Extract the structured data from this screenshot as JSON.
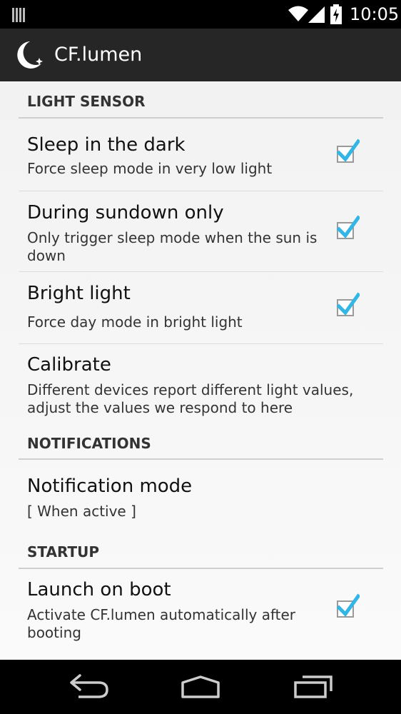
{
  "status_bar": {
    "time": "10:05",
    "icons": [
      "notification-bars-icon",
      "wifi-icon",
      "signal-icon",
      "battery-charging-icon"
    ]
  },
  "action_bar": {
    "app_icon": "moon-icon",
    "title": "CF.lumen"
  },
  "categories": {
    "light_sensor": "LIGHT SENSOR",
    "notifications": "NOTIFICATIONS",
    "startup": "STARTUP"
  },
  "preferences": {
    "sleep_dark": {
      "title": "Sleep in the dark",
      "summary": "Force sleep mode in very low light",
      "checked": true
    },
    "sundown_only": {
      "title": "During sundown only",
      "summary_line1": "Only trigger sleep mode when the sun is",
      "summary_line2": "down",
      "checked": true
    },
    "bright_light": {
      "title": "Bright light",
      "summary": "Force day mode in bright light",
      "checked": true
    },
    "calibrate": {
      "title": "Calibrate",
      "summary_line1": "Different devices report different light values,",
      "summary_line2": "adjust the values we respond to here"
    },
    "notification_mode": {
      "title": "Notification mode",
      "summary": "[ When active ]"
    },
    "launch_on_boot": {
      "title": "Launch on boot",
      "summary_line1": "Activate CF.lumen automatically after",
      "summary_line2": "booting",
      "checked": true
    }
  },
  "nav_bar": {
    "icons": [
      "back-icon",
      "home-icon",
      "recent-apps-icon"
    ]
  },
  "colors": {
    "check_accent": "#33b5e5",
    "action_bar": "#262626",
    "divider": "#cfcfcf"
  }
}
